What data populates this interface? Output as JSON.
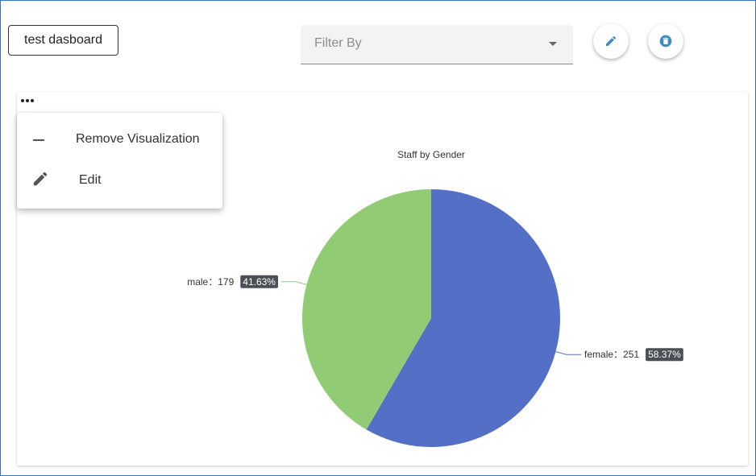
{
  "dashboard": {
    "title": "test dasboard"
  },
  "filter": {
    "placeholder": "Filter By"
  },
  "actions": {
    "edit_icon": "pencil-icon",
    "delete_icon": "trash-icon",
    "accent": "#3d8cc4"
  },
  "menu": {
    "items": [
      {
        "label": "Remove Visualization",
        "icon": "minus-icon"
      },
      {
        "label": "Edit",
        "icon": "pencil-icon"
      }
    ]
  },
  "chart_data": {
    "type": "pie",
    "title": "Staff by Gender",
    "slices": [
      {
        "name": "female",
        "value": 251,
        "percent": "58.37%",
        "color": "#5470c6"
      },
      {
        "name": "male",
        "value": 179,
        "percent": "41.63%",
        "color": "#91cc75"
      }
    ],
    "labels": [
      {
        "text": "female：251",
        "pct": "58.37%"
      },
      {
        "text": "male：179",
        "pct": "41.63%"
      }
    ],
    "label_badge_color": "#4a4f55"
  }
}
